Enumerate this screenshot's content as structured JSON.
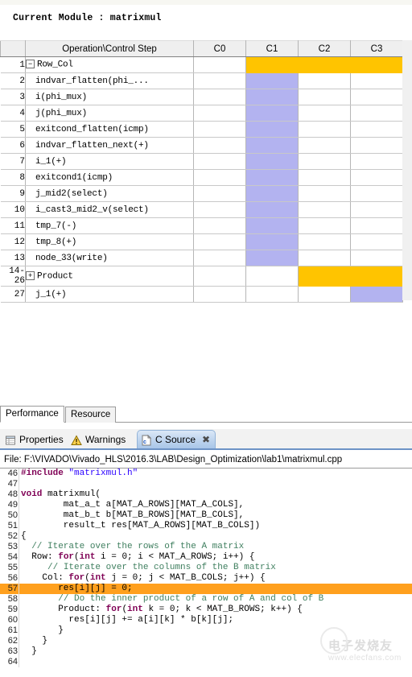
{
  "header": {
    "module_label": "Current Module : matrixmul"
  },
  "schedule": {
    "columns": [
      "Operation\\Control Step",
      "C0",
      "C1",
      "C2",
      "C3"
    ],
    "index_header": "",
    "rows": [
      {
        "index": "1",
        "label": "Row_Col",
        "indent": 0,
        "toggle": "minus",
        "cells": [
          "",
          "orange",
          "orange",
          "orange"
        ]
      },
      {
        "index": "2",
        "label": "indvar_flatten(phi_...",
        "indent": 1,
        "toggle": "",
        "cells": [
          "",
          "purple",
          "",
          ""
        ]
      },
      {
        "index": "3",
        "label": "i(phi_mux)",
        "indent": 1,
        "toggle": "",
        "cells": [
          "",
          "purple",
          "",
          ""
        ]
      },
      {
        "index": "4",
        "label": "j(phi_mux)",
        "indent": 1,
        "toggle": "",
        "cells": [
          "",
          "purple",
          "",
          ""
        ]
      },
      {
        "index": "5",
        "label": "exitcond_flatten(icmp)",
        "indent": 1,
        "toggle": "",
        "cells": [
          "",
          "purple",
          "",
          ""
        ]
      },
      {
        "index": "6",
        "label": "indvar_flatten_next(+)",
        "indent": 1,
        "toggle": "",
        "cells": [
          "",
          "purple",
          "",
          ""
        ]
      },
      {
        "index": "7",
        "label": "i_1(+)",
        "indent": 1,
        "toggle": "",
        "cells": [
          "",
          "purple",
          "",
          ""
        ]
      },
      {
        "index": "8",
        "label": "exitcond1(icmp)",
        "indent": 1,
        "toggle": "",
        "cells": [
          "",
          "purple",
          "",
          ""
        ]
      },
      {
        "index": "9",
        "label": "j_mid2(select)",
        "indent": 1,
        "toggle": "",
        "cells": [
          "",
          "purple",
          "",
          ""
        ]
      },
      {
        "index": "10",
        "label": "i_cast3_mid2_v(select)",
        "indent": 1,
        "toggle": "",
        "cells": [
          "",
          "purple",
          "",
          ""
        ]
      },
      {
        "index": "11",
        "label": "tmp_7(-)",
        "indent": 1,
        "toggle": "",
        "cells": [
          "",
          "purple",
          "",
          ""
        ]
      },
      {
        "index": "12",
        "label": "tmp_8(+)",
        "indent": 1,
        "toggle": "",
        "cells": [
          "",
          "purple",
          "",
          ""
        ]
      },
      {
        "index": "13",
        "label": "node_33(write)",
        "indent": 1,
        "toggle": "",
        "cells": [
          "",
          "purple",
          "",
          ""
        ]
      },
      {
        "index": "14-26",
        "label": "Product",
        "indent": 0,
        "toggle": "plus",
        "cells": [
          "",
          "",
          "orange",
          "orange"
        ]
      },
      {
        "index": "27",
        "label": "j_1(+)",
        "indent": 1,
        "toggle": "",
        "cells": [
          "",
          "",
          "",
          "purple"
        ]
      }
    ],
    "colors": {
      "orange": "#ffc400",
      "purple": "#b3b3f0",
      "row_header_bg": "#e9e9e9",
      "focus_border": "#3333cc"
    }
  },
  "lower_tabs": [
    {
      "label": "Performance",
      "selected": true
    },
    {
      "label": "Resource",
      "selected": false
    }
  ],
  "view_tabs": [
    {
      "label": "Properties",
      "icon": "properties-icon",
      "selected": false,
      "closable": false
    },
    {
      "label": "Warnings",
      "icon": "warning-icon",
      "selected": false,
      "closable": false
    },
    {
      "label": "C Source",
      "icon": "c-file-icon",
      "selected": true,
      "closable": true,
      "close_glyph": "✖"
    }
  ],
  "file_bar": {
    "text": "File: F:\\VIVADO\\Vivado_HLS\\2016.3\\LAB\\Design_Optimization\\lab1\\matrixmul.cpp"
  },
  "code": {
    "highlight_line": "57",
    "highlight_color": "#ffa01e",
    "lines": [
      {
        "n": "46",
        "segs": [
          {
            "t": "#include ",
            "c": "pp"
          },
          {
            "t": "\"matrixmul.h\"",
            "c": "str"
          }
        ]
      },
      {
        "n": "47",
        "segs": [
          {
            "t": "",
            "c": ""
          }
        ]
      },
      {
        "n": "48",
        "segs": [
          {
            "t": "void",
            "c": "kw"
          },
          {
            "t": " matrixmul(",
            "c": ""
          }
        ]
      },
      {
        "n": "49",
        "segs": [
          {
            "t": "        mat_a_t a[MAT_A_ROWS][MAT_A_COLS],",
            "c": ""
          }
        ]
      },
      {
        "n": "50",
        "segs": [
          {
            "t": "        mat_b_t b[MAT_B_ROWS][MAT_B_COLS],",
            "c": ""
          }
        ]
      },
      {
        "n": "51",
        "segs": [
          {
            "t": "        result_t res[MAT_A_ROWS][MAT_B_COLS])",
            "c": ""
          }
        ]
      },
      {
        "n": "52",
        "segs": [
          {
            "t": "{",
            "c": ""
          }
        ]
      },
      {
        "n": "53",
        "segs": [
          {
            "t": "  ",
            "c": ""
          },
          {
            "t": "// Iterate over the rows of the A matrix",
            "c": "cmt"
          }
        ]
      },
      {
        "n": "54",
        "segs": [
          {
            "t": "  Row: ",
            "c": ""
          },
          {
            "t": "for",
            "c": "kw"
          },
          {
            "t": "(",
            "c": ""
          },
          {
            "t": "int",
            "c": "kw"
          },
          {
            "t": " i = 0; i < MAT_A_ROWS; i++) {",
            "c": ""
          }
        ]
      },
      {
        "n": "55",
        "segs": [
          {
            "t": "     ",
            "c": ""
          },
          {
            "t": "// Iterate over the columns of the B matrix",
            "c": "cmt"
          }
        ]
      },
      {
        "n": "56",
        "segs": [
          {
            "t": "    Col: ",
            "c": ""
          },
          {
            "t": "for",
            "c": "kw"
          },
          {
            "t": "(",
            "c": ""
          },
          {
            "t": "int",
            "c": "kw"
          },
          {
            "t": " j = 0; j < MAT_B_COLS; j++) {",
            "c": ""
          }
        ]
      },
      {
        "n": "57",
        "segs": [
          {
            "t": "       res[i][j] = 0;",
            "c": ""
          }
        ]
      },
      {
        "n": "58",
        "segs": [
          {
            "t": "       ",
            "c": ""
          },
          {
            "t": "// Do the inner product of a row of A and col of B",
            "c": "cmt"
          }
        ]
      },
      {
        "n": "59",
        "segs": [
          {
            "t": "       Product: ",
            "c": ""
          },
          {
            "t": "for",
            "c": "kw"
          },
          {
            "t": "(",
            "c": ""
          },
          {
            "t": "int",
            "c": "kw"
          },
          {
            "t": " k = 0; k < MAT_B_ROWS; k++) {",
            "c": ""
          }
        ]
      },
      {
        "n": "60",
        "segs": [
          {
            "t": "         res[i][j] += a[i][k] * b[k][j];",
            "c": ""
          }
        ]
      },
      {
        "n": "61",
        "segs": [
          {
            "t": "       }",
            "c": ""
          }
        ]
      },
      {
        "n": "62",
        "segs": [
          {
            "t": "    }",
            "c": ""
          }
        ]
      },
      {
        "n": "63",
        "segs": [
          {
            "t": "  }",
            "c": ""
          }
        ]
      },
      {
        "n": "64",
        "segs": [
          {
            "t": "",
            "c": ""
          }
        ]
      }
    ]
  },
  "watermark": {
    "cn": "电子发烧友",
    "url": "www.elecfans.com"
  }
}
